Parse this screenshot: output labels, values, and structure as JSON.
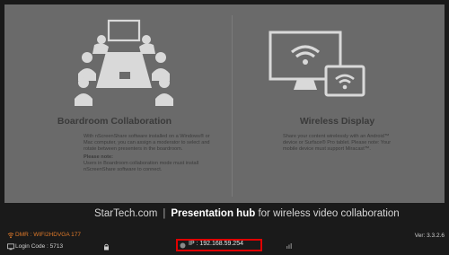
{
  "screen": {
    "boardroom": {
      "title": "Boardroom Collaboration",
      "body": "With nScreenShare software installed on a Windows® or Mac computer, you can assign a moderator to select and rotate between presenters in the boardroom.",
      "note_label": "Please note:",
      "note_body": "Users in Boardroom collaboration mode must install nScreenShare software to connect."
    },
    "wireless": {
      "title": "Wireless Display",
      "body": "Share your content wirelessly with an Android™ device or Surface® Pro tablet. Please note: Your mobile device must support Miracast™."
    }
  },
  "footer": {
    "brand": "StarTech.com",
    "hub_bold": "Presentation hub",
    "hub_rest": "for wireless video collaboration",
    "dmr": "DMR : WIFI2HDVGA 177",
    "login": "Login Code : 5713",
    "ip": "IP : 192.168.59.254",
    "version": "Ver: 3.3.2.6"
  },
  "colors": {
    "screen_bg": "#6a6a6a",
    "dmr_text": "#e07a2a",
    "highlight_box": "#e00000"
  }
}
